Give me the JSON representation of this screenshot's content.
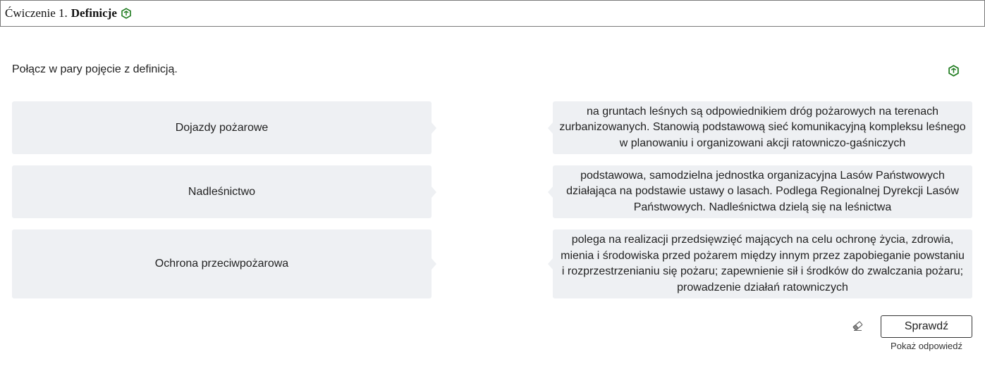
{
  "header": {
    "prefix": "Ćwiczenie 1.",
    "title": "Definicje",
    "icon": "hexagon-icon",
    "icon_color": "#1e7b1e"
  },
  "instruction": {
    "text": "Połącz w pary pojęcie z definicją.",
    "icon": "hexagon-icon"
  },
  "pairs": [
    {
      "term": "Dojazdy pożarowe",
      "definition": "na gruntach leśnych są odpowiednikiem dróg pożarowych na terenach zurbanizowanych. Stanowią podstawową sieć komunikacyjną kompleksu leśnego w planowaniu i organizowani akcji ratowniczo-gaśniczych"
    },
    {
      "term": "Nadleśnictwo",
      "definition": "podstawowa, samodzielna jednostka organizacyjna Lasów Państwowych działająca na podstawie ustawy o lasach. Podlega Regionalnej Dyrekcji Lasów Państwowych. Nadleśnictwa dzielą się na leśnictwa"
    },
    {
      "term": "Ochrona przeciwpożarowa",
      "definition": "polega na realizacji przedsięwzięć mających na celu ochronę życia, zdrowia, mienia i środowiska przed pożarem między innym przez zapobieganie powstaniu i rozprzestrzenianiu się pożaru; zapewnienie sił i środków do zwalczania pożaru; prowadzenie działań ratowniczych"
    }
  ],
  "controls": {
    "reset_icon": "eraser-icon",
    "check_label": "Sprawdź",
    "show_answer_label": "Pokaż odpowiedź"
  },
  "colors": {
    "accent": "#1e7b1e",
    "tile_background": "#eef0f3"
  }
}
